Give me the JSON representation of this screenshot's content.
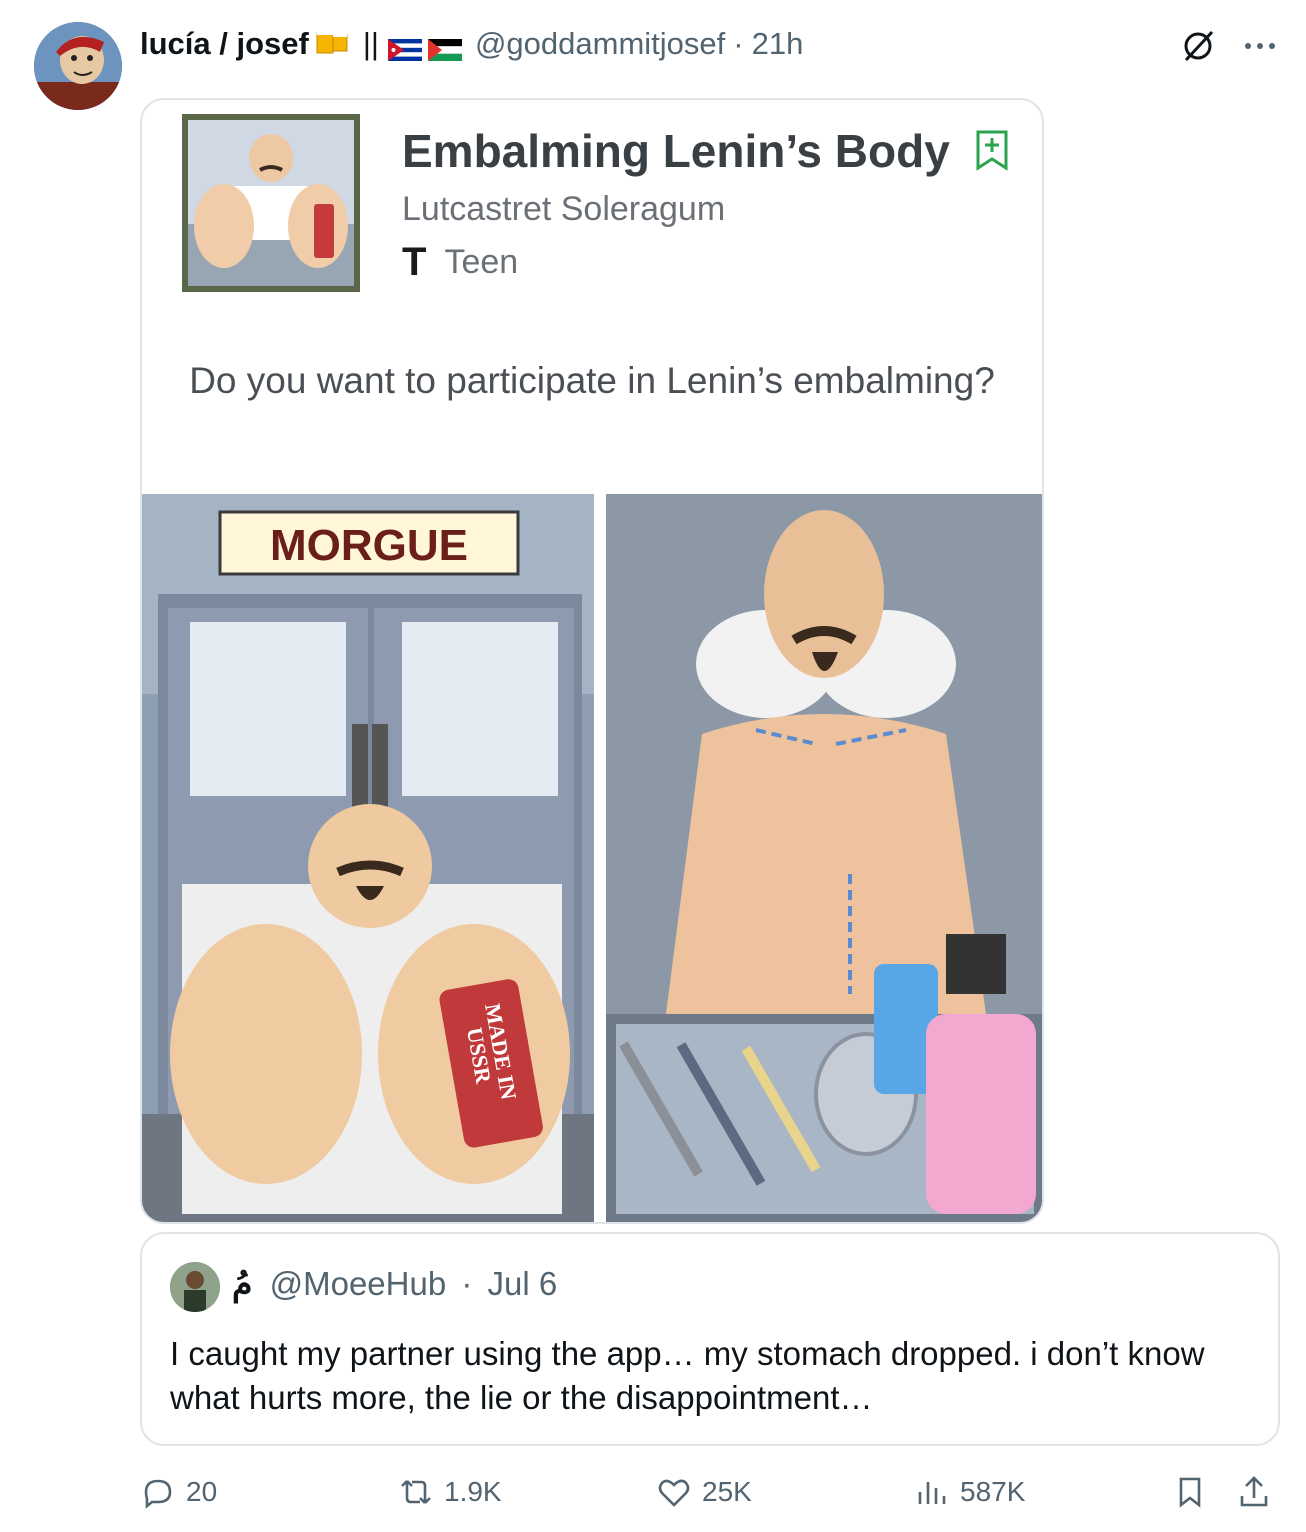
{
  "post": {
    "display_name": "lucía / josef",
    "handle": "@goddammitjosef",
    "separator": "·",
    "time": "21h",
    "divider": "||"
  },
  "card": {
    "title": "Embalming Lenin’s Body",
    "author": "Lutcastret Soleragum",
    "rating": "Teen",
    "question": "Do you want to participate in Lenin’s embalming?",
    "sign_label": "MORGUE",
    "tag_label_1": "MADE IN",
    "tag_label_2": "USSR"
  },
  "quote": {
    "arabic_name": "مُ",
    "handle": "@MoeeHub",
    "separator": "·",
    "date": "Jul 6",
    "text": "I caught my partner using the app… my stomach dropped. i don’t know what hurts more, the lie or the disappointment…"
  },
  "actions": {
    "replies": "20",
    "reposts": "1.9K",
    "likes": "25K",
    "views": "587K"
  },
  "icons": [
    "grok-icon",
    "more-icon",
    "reply-icon",
    "repost-icon",
    "like-icon",
    "views-icon",
    "bookmark-icon",
    "share-icon"
  ],
  "colors": {
    "muted": "#536471",
    "border": "#dfe4e8",
    "text": "#0f1419"
  }
}
